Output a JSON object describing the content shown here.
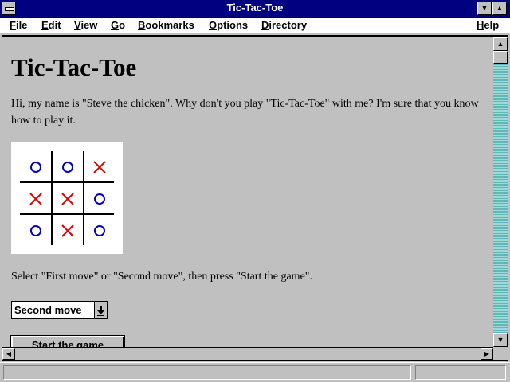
{
  "window": {
    "title": "Tic-Tac-Toe",
    "minimize_glyph": "▼",
    "maximize_glyph": "▲"
  },
  "menu": [
    "File",
    "Edit",
    "View",
    "Go",
    "Bookmarks",
    "Options",
    "Directory",
    "Help"
  ],
  "page": {
    "heading": "Tic-Tac-Toe",
    "intro": "Hi, my name is \"Steve the chicken\". Why don't you play \"Tic-Tac-Toe\" with me? I'm sure that you know how to play it.",
    "instructions": "Select \"First move\" or \"Second move\", then press \"Start the game\".",
    "select_value": "Second move",
    "start_button": "Start the game"
  },
  "board": [
    [
      "O",
      "O",
      "X"
    ],
    [
      "X",
      "X",
      "O"
    ],
    [
      "O",
      "X",
      "O"
    ]
  ],
  "colors": {
    "x_mark": "#e00000",
    "o_mark": "#0000c0",
    "titlebar": "#000080"
  },
  "status": {
    "text": ""
  }
}
